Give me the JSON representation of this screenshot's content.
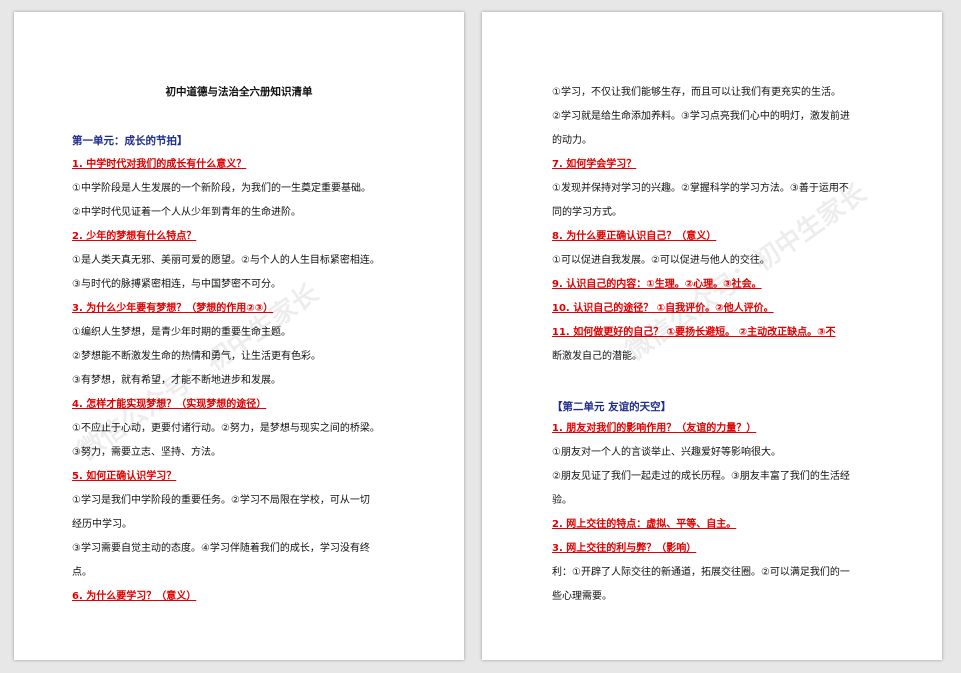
{
  "left_page": {
    "title": "初中道德与法治全六册知识清单",
    "lines": [
      {
        "t": "第一单元：成长的节拍】",
        "k": "unit"
      },
      {
        "t": "1. 中学时代对我们的成长有什么意义？",
        "k": "q"
      },
      {
        "t": "①中学阶段是人生发展的一个新阶段，为我们的一生奠定重要基础。",
        "k": "b"
      },
      {
        "t": "②中学时代见证着一个人从少年到青年的生命进阶。",
        "k": "b"
      },
      {
        "t": "2. 少年的梦想有什么特点？",
        "k": "q"
      },
      {
        "t": "①是人类天真无邪、美丽可爱的愿望。②与个人的人生目标紧密相连。",
        "k": "b"
      },
      {
        "t": "③与时代的脉搏紧密相连，与中国梦密不可分。",
        "k": "b"
      },
      {
        "t": "3. 为什么少年要有梦想？（梦想的作用②③）",
        "k": "q"
      },
      {
        "t": "①编织人生梦想，是青少年时期的重要生命主题。",
        "k": "b"
      },
      {
        "t": "②梦想能不断激发生命的热情和勇气，让生活更有色彩。",
        "k": "b"
      },
      {
        "t": "③有梦想，就有希望，才能不断地进步和发展。",
        "k": "b"
      },
      {
        "t": "4. 怎样才能实现梦想？（实现梦想的途径）",
        "k": "q"
      },
      {
        "t": "①不应止于心动，更要付诸行动。②努力，是梦想与现实之间的桥梁。",
        "k": "b"
      },
      {
        "t": "③努力，需要立志、坚持、方法。",
        "k": "b"
      },
      {
        "t": "5. 如何正确认识学习？",
        "k": "q"
      },
      {
        "t": "①学习是我们中学阶段的重要任务。②学习不局限在学校，可从一切",
        "k": "b"
      },
      {
        "t": "经历中学习。",
        "k": "b"
      },
      {
        "t": "③学习需要自觉主动的态度。④学习伴随着我们的成长，学习没有终",
        "k": "b"
      },
      {
        "t": "点。",
        "k": "b"
      },
      {
        "t": "6. 为什么要学习？（意义）",
        "k": "q"
      }
    ]
  },
  "right_page": {
    "lines": [
      {
        "t": "①学习，不仅让我们能够生存，而且可以让我们有更充实的生活。",
        "k": "b"
      },
      {
        "t": "②学习就是给生命添加养料。③学习点亮我们心中的明灯，激发前进",
        "k": "b"
      },
      {
        "t": "的动力。",
        "k": "b"
      },
      {
        "t": "7. 如何学会学习？",
        "k": "q"
      },
      {
        "t": "①发现并保持对学习的兴趣。②掌握科学的学习方法。③善于运用不",
        "k": "b"
      },
      {
        "t": "同的学习方式。",
        "k": "b"
      },
      {
        "t": "8. 为什么要正确认识自己？（意义）",
        "k": "q"
      },
      {
        "t": "①可以促进自我发展。②可以促进与他人的交往。",
        "k": "b"
      },
      {
        "t": "9. 认识自己的内容：①生理。②心理。③社会。",
        "k": "q"
      },
      {
        "t": "10. 认识自己的途径？ ①自我评价。②他人评价。",
        "k": "q"
      },
      {
        "t": "11. 如何做更好的自己？ ①要扬长避短。 ②主动改正缺点。③不",
        "k": "q"
      },
      {
        "t": "断激发自己的潜能。",
        "k": "b"
      },
      {
        "t": "【第二单元 友谊的天空】",
        "k": "unit"
      },
      {
        "t": "1. 朋友对我们的影响作用？（友谊的力量？）",
        "k": "q"
      },
      {
        "t": "①朋友对一个人的言谈举止、兴趣爱好等影响很大。",
        "k": "b"
      },
      {
        "t": "②朋友见证了我们一起走过的成长历程。③朋友丰富了我们的生活经",
        "k": "b"
      },
      {
        "t": "验。",
        "k": "b"
      },
      {
        "t": "2. 网上交往的特点：虚拟、平等、自主。",
        "k": "q"
      },
      {
        "t": "3. 网上交往的利与弊？（影响）",
        "k": "q"
      },
      {
        "t": "利：①开辟了人际交往的新通道，拓展交往圈。②可以满足我们的一",
        "k": "b"
      },
      {
        "t": "些心理需要。",
        "k": "b"
      }
    ]
  },
  "watermark": "微信公众号：初中生家长",
  "colors": {
    "question": "#e00000",
    "unit": "#1f2e8a",
    "body": "#111111"
  }
}
